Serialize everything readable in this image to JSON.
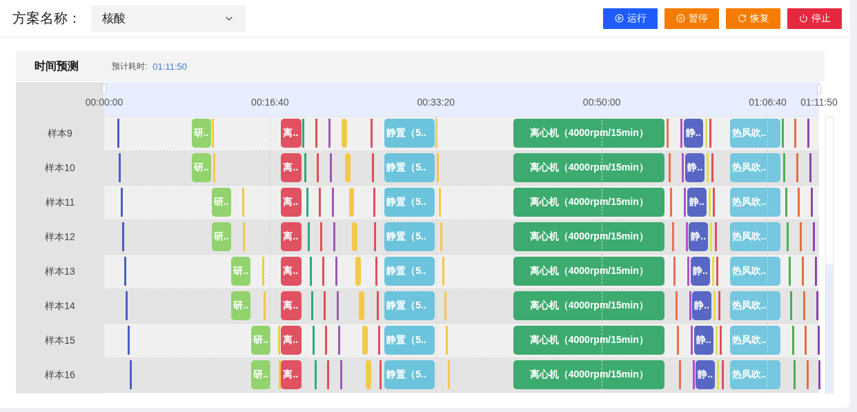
{
  "header": {
    "label": "方案名称：",
    "select": {
      "value": "核酸"
    },
    "buttons": [
      {
        "label": "运行",
        "kind": "run"
      },
      {
        "label": "暂停",
        "kind": "pause"
      },
      {
        "label": "恢复",
        "kind": "resume"
      },
      {
        "label": "停止",
        "kind": "stop"
      }
    ]
  },
  "panel": {
    "title": "时间预测",
    "estimate_label": "预计耗时:",
    "estimate_value": "01:11:50"
  },
  "timeline": {
    "ticks": [
      {
        "label": "00:00:00"
      },
      {
        "label": "00:16:40"
      },
      {
        "label": "00:33:20"
      },
      {
        "label": "00:50:00"
      },
      {
        "label": "01:06:40"
      },
      {
        "label": "01:11:50"
      }
    ],
    "rows": [
      {
        "label": "样本9",
        "items": [
          {
            "kind": "line",
            "color": "#4a5fc1"
          },
          {
            "kind": "block",
            "label": "研..",
            "color": "#92d36e"
          },
          {
            "kind": "line",
            "color": "#f2c94c"
          },
          {
            "kind": "block",
            "label": "离..",
            "color": "#e05262"
          },
          {
            "kind": "line",
            "color": "#2fa87a"
          },
          {
            "kind": "line",
            "color": "#d9534f"
          },
          {
            "kind": "line",
            "color": "#9b59b6"
          },
          {
            "kind": "block",
            "color": "#f2c94c"
          },
          {
            "kind": "line",
            "color": "#e04e5a"
          },
          {
            "kind": "block",
            "label": "静置（5..",
            "color": "#6cc4dc"
          },
          {
            "kind": "line",
            "color": "#f2c94c"
          },
          {
            "kind": "block",
            "label": "离心机（4000rpm/15min）",
            "color": "#3dab6f"
          },
          {
            "kind": "line",
            "color": "#e8704a"
          },
          {
            "kind": "line",
            "color": "#b44fc9"
          },
          {
            "kind": "block",
            "label": "静..",
            "color": "#5867c4"
          },
          {
            "kind": "line",
            "color": "#dfe04d"
          },
          {
            "kind": "line",
            "color": "#e04e5a"
          },
          {
            "kind": "block",
            "label": "热风吹..",
            "color": "#74c7de"
          },
          {
            "kind": "line",
            "color": "#4caf50"
          },
          {
            "kind": "line",
            "color": "#e07040"
          },
          {
            "kind": "line",
            "color": "#8e44ad"
          }
        ]
      },
      {
        "label": "样本10",
        "items": [
          {
            "kind": "line",
            "color": "#4a5fc1"
          },
          {
            "kind": "block",
            "label": "研..",
            "color": "#92d36e"
          },
          {
            "kind": "line",
            "color": "#f2c94c"
          },
          {
            "kind": "block",
            "label": "离..",
            "color": "#e05262"
          },
          {
            "kind": "line",
            "color": "#2fa87a"
          },
          {
            "kind": "line",
            "color": "#d9534f"
          },
          {
            "kind": "line",
            "color": "#9b59b6"
          },
          {
            "kind": "block",
            "color": "#f2c94c"
          },
          {
            "kind": "line",
            "color": "#e04e5a"
          },
          {
            "kind": "block",
            "label": "静置（5..",
            "color": "#6cc4dc"
          },
          {
            "kind": "line",
            "color": "#f2c94c"
          },
          {
            "kind": "block",
            "label": "离心机（4000rpm/15min）",
            "color": "#3dab6f"
          },
          {
            "kind": "line",
            "color": "#e8704a"
          },
          {
            "kind": "line",
            "color": "#b44fc9"
          },
          {
            "kind": "block",
            "label": "静..",
            "color": "#5867c4"
          },
          {
            "kind": "line",
            "color": "#dfe04d"
          },
          {
            "kind": "line",
            "color": "#e04e5a"
          },
          {
            "kind": "block",
            "label": "热风吹..",
            "color": "#74c7de"
          },
          {
            "kind": "line",
            "color": "#4caf50"
          },
          {
            "kind": "line",
            "color": "#e07040"
          },
          {
            "kind": "line",
            "color": "#8e44ad"
          }
        ]
      },
      {
        "label": "样本11",
        "items": [
          {
            "kind": "line",
            "color": "#4a5fc1"
          },
          {
            "kind": "block",
            "label": "研..",
            "color": "#92d36e"
          },
          {
            "kind": "line",
            "color": "#f2c94c"
          },
          {
            "kind": "block",
            "label": "离..",
            "color": "#e05262"
          },
          {
            "kind": "line",
            "color": "#2fa87a"
          },
          {
            "kind": "line",
            "color": "#d9534f"
          },
          {
            "kind": "line",
            "color": "#9b59b6"
          },
          {
            "kind": "block",
            "color": "#f2c94c"
          },
          {
            "kind": "line",
            "color": "#e04e5a"
          },
          {
            "kind": "block",
            "label": "静置（5..",
            "color": "#6cc4dc"
          },
          {
            "kind": "line",
            "color": "#f2c94c"
          },
          {
            "kind": "block",
            "label": "离心机（4000rpm/15min）",
            "color": "#3dab6f"
          },
          {
            "kind": "line",
            "color": "#e8704a"
          },
          {
            "kind": "line",
            "color": "#b44fc9"
          },
          {
            "kind": "block",
            "label": "静..",
            "color": "#5867c4"
          },
          {
            "kind": "line",
            "color": "#dfe04d"
          },
          {
            "kind": "line",
            "color": "#e04e5a"
          },
          {
            "kind": "block",
            "label": "热风吹..",
            "color": "#74c7de"
          },
          {
            "kind": "line",
            "color": "#4caf50"
          },
          {
            "kind": "line",
            "color": "#e07040"
          },
          {
            "kind": "line",
            "color": "#8e44ad"
          }
        ]
      },
      {
        "label": "样本12",
        "items": [
          {
            "kind": "line",
            "color": "#4a5fc1"
          },
          {
            "kind": "block",
            "label": "研..",
            "color": "#92d36e"
          },
          {
            "kind": "line",
            "color": "#f2c94c"
          },
          {
            "kind": "block",
            "label": "离..",
            "color": "#e05262"
          },
          {
            "kind": "line",
            "color": "#2fa87a"
          },
          {
            "kind": "line",
            "color": "#d9534f"
          },
          {
            "kind": "line",
            "color": "#9b59b6"
          },
          {
            "kind": "block",
            "color": "#f2c94c"
          },
          {
            "kind": "line",
            "color": "#e04e5a"
          },
          {
            "kind": "block",
            "label": "静置（5..",
            "color": "#6cc4dc"
          },
          {
            "kind": "line",
            "color": "#f2c94c"
          },
          {
            "kind": "block",
            "label": "离心机（4000rpm/15min）",
            "color": "#3dab6f"
          },
          {
            "kind": "line",
            "color": "#e8704a"
          },
          {
            "kind": "line",
            "color": "#b44fc9"
          },
          {
            "kind": "block",
            "label": "静..",
            "color": "#5867c4"
          },
          {
            "kind": "line",
            "color": "#dfe04d"
          },
          {
            "kind": "line",
            "color": "#e04e5a"
          },
          {
            "kind": "block",
            "label": "热风吹..",
            "color": "#74c7de"
          },
          {
            "kind": "line",
            "color": "#4caf50"
          },
          {
            "kind": "line",
            "color": "#e07040"
          },
          {
            "kind": "line",
            "color": "#8e44ad"
          }
        ]
      },
      {
        "label": "样本13",
        "items": [
          {
            "kind": "line",
            "color": "#4a5fc1"
          },
          {
            "kind": "block",
            "label": "研..",
            "color": "#92d36e"
          },
          {
            "kind": "line",
            "color": "#f2c94c"
          },
          {
            "kind": "block",
            "label": "离..",
            "color": "#e05262"
          },
          {
            "kind": "line",
            "color": "#2fa87a"
          },
          {
            "kind": "line",
            "color": "#d9534f"
          },
          {
            "kind": "line",
            "color": "#9b59b6"
          },
          {
            "kind": "block",
            "color": "#f2c94c"
          },
          {
            "kind": "line",
            "color": "#e04e5a"
          },
          {
            "kind": "block",
            "label": "静置（5..",
            "color": "#6cc4dc"
          },
          {
            "kind": "line",
            "color": "#f2c94c"
          },
          {
            "kind": "block",
            "label": "离心机（4000rpm/15min）",
            "color": "#3dab6f"
          },
          {
            "kind": "line",
            "color": "#e8704a"
          },
          {
            "kind": "line",
            "color": "#b44fc9"
          },
          {
            "kind": "block",
            "label": "静..",
            "color": "#5867c4"
          },
          {
            "kind": "line",
            "color": "#dfe04d"
          },
          {
            "kind": "line",
            "color": "#e04e5a"
          },
          {
            "kind": "block",
            "label": "热风吹..",
            "color": "#74c7de"
          },
          {
            "kind": "line",
            "color": "#4caf50"
          },
          {
            "kind": "line",
            "color": "#e07040"
          },
          {
            "kind": "line",
            "color": "#8e44ad"
          }
        ]
      },
      {
        "label": "样本14",
        "items": [
          {
            "kind": "line",
            "color": "#4a5fc1"
          },
          {
            "kind": "block",
            "label": "研..",
            "color": "#92d36e"
          },
          {
            "kind": "line",
            "color": "#f2c94c"
          },
          {
            "kind": "block",
            "label": "离..",
            "color": "#e05262"
          },
          {
            "kind": "line",
            "color": "#2fa87a"
          },
          {
            "kind": "line",
            "color": "#d9534f"
          },
          {
            "kind": "line",
            "color": "#9b59b6"
          },
          {
            "kind": "block",
            "color": "#f2c94c"
          },
          {
            "kind": "line",
            "color": "#e04e5a"
          },
          {
            "kind": "block",
            "label": "静置（5..",
            "color": "#6cc4dc"
          },
          {
            "kind": "line",
            "color": "#f2c94c"
          },
          {
            "kind": "block",
            "label": "离心机（4000rpm/15min）",
            "color": "#3dab6f"
          },
          {
            "kind": "line",
            "color": "#e8704a"
          },
          {
            "kind": "line",
            "color": "#b44fc9"
          },
          {
            "kind": "block",
            "label": "静..",
            "color": "#5867c4"
          },
          {
            "kind": "line",
            "color": "#dfe04d"
          },
          {
            "kind": "line",
            "color": "#e04e5a"
          },
          {
            "kind": "block",
            "label": "热风吹..",
            "color": "#74c7de"
          },
          {
            "kind": "line",
            "color": "#4caf50"
          },
          {
            "kind": "line",
            "color": "#e07040"
          },
          {
            "kind": "line",
            "color": "#8e44ad"
          }
        ]
      },
      {
        "label": "样本15",
        "items": [
          {
            "kind": "line",
            "color": "#4a5fc1"
          },
          {
            "kind": "block",
            "label": "研..",
            "color": "#92d36e"
          },
          {
            "kind": "line",
            "color": "#f2c94c"
          },
          {
            "kind": "block",
            "label": "离..",
            "color": "#e05262"
          },
          {
            "kind": "line",
            "color": "#2fa87a"
          },
          {
            "kind": "line",
            "color": "#d9534f"
          },
          {
            "kind": "line",
            "color": "#9b59b6"
          },
          {
            "kind": "block",
            "color": "#f2c94c"
          },
          {
            "kind": "line",
            "color": "#e04e5a"
          },
          {
            "kind": "block",
            "label": "静置（5..",
            "color": "#6cc4dc"
          },
          {
            "kind": "line",
            "color": "#f2c94c"
          },
          {
            "kind": "block",
            "label": "离心机（4000rpm/15min）",
            "color": "#3dab6f"
          },
          {
            "kind": "line",
            "color": "#e8704a"
          },
          {
            "kind": "line",
            "color": "#b44fc9"
          },
          {
            "kind": "block",
            "label": "静..",
            "color": "#5867c4"
          },
          {
            "kind": "line",
            "color": "#dfe04d"
          },
          {
            "kind": "line",
            "color": "#e04e5a"
          },
          {
            "kind": "block",
            "label": "热风吹..",
            "color": "#74c7de"
          },
          {
            "kind": "line",
            "color": "#4caf50"
          },
          {
            "kind": "line",
            "color": "#e07040"
          },
          {
            "kind": "line",
            "color": "#8e44ad"
          }
        ]
      },
      {
        "label": "样本16",
        "items": [
          {
            "kind": "line",
            "color": "#4a5fc1"
          },
          {
            "kind": "block",
            "label": "研..",
            "color": "#92d36e"
          },
          {
            "kind": "line",
            "color": "#f2c94c"
          },
          {
            "kind": "block",
            "label": "离..",
            "color": "#e05262"
          },
          {
            "kind": "line",
            "color": "#2fa87a"
          },
          {
            "kind": "line",
            "color": "#d9534f"
          },
          {
            "kind": "line",
            "color": "#9b59b6"
          },
          {
            "kind": "block",
            "color": "#f2c94c"
          },
          {
            "kind": "line",
            "color": "#e04e5a"
          },
          {
            "kind": "block",
            "label": "静置（5..",
            "color": "#6cc4dc"
          },
          {
            "kind": "line",
            "color": "#f2c94c"
          },
          {
            "kind": "block",
            "label": "离心机（4000rpm/15min）",
            "color": "#3dab6f"
          },
          {
            "kind": "line",
            "color": "#e8704a"
          },
          {
            "kind": "line",
            "color": "#b44fc9"
          },
          {
            "kind": "block",
            "label": "静..",
            "color": "#5867c4"
          },
          {
            "kind": "line",
            "color": "#dfe04d"
          },
          {
            "kind": "line",
            "color": "#e04e5a"
          },
          {
            "kind": "block",
            "label": "热风吹..",
            "color": "#74c7de"
          },
          {
            "kind": "line",
            "color": "#4caf50"
          },
          {
            "kind": "line",
            "color": "#e07040"
          },
          {
            "kind": "line",
            "color": "#8e44ad"
          }
        ]
      }
    ]
  }
}
